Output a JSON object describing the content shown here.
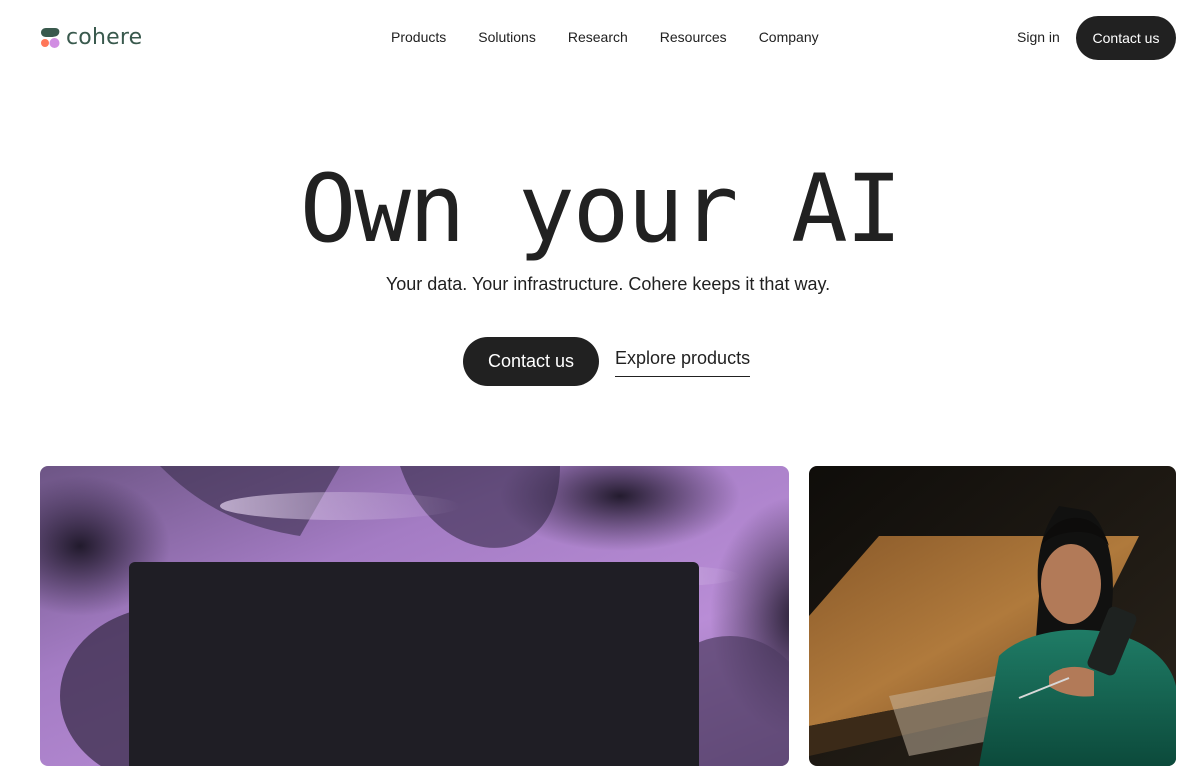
{
  "brand": {
    "name": "cohere",
    "colors": {
      "text": "#39594d",
      "mark_green": "#39594d",
      "mark_coral": "#ff7759",
      "mark_purple": "#d18ee2"
    }
  },
  "nav": {
    "links": [
      "Products",
      "Solutions",
      "Research",
      "Resources",
      "Company"
    ],
    "signin_label": "Sign in",
    "cta_label": "Contact us"
  },
  "hero": {
    "title": "Own your AI",
    "subtitle": "Your data. Your infrastructure. Cohere keeps it that way.",
    "primary_cta": "Contact us",
    "secondary_cta": "Explore products"
  },
  "media": {
    "left": {
      "icon": "abstract-purple-product-image"
    },
    "right": {
      "icon": "woman-on-phone-photo"
    }
  },
  "colors": {
    "ink": "#212121",
    "background": "#ffffff",
    "purple": "#b07fd0",
    "panel_dark": "#1f1e25"
  }
}
